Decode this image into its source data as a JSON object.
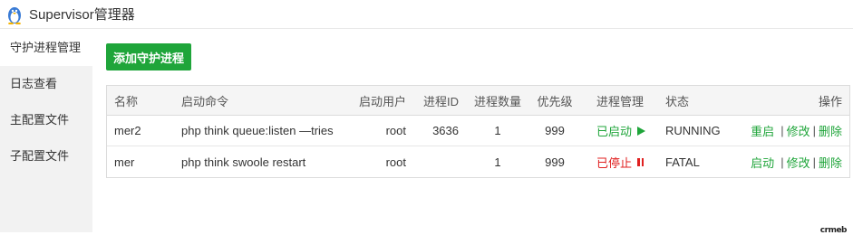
{
  "header": {
    "title": "Supervisor管理器",
    "logo_icon": "penguin-icon"
  },
  "sidebar": {
    "items": [
      {
        "label": "守护进程管理",
        "active": true
      },
      {
        "label": "日志查看",
        "active": false
      },
      {
        "label": "主配置文件",
        "active": false
      },
      {
        "label": "子配置文件",
        "active": false
      }
    ]
  },
  "main": {
    "add_button_label": "添加守护进程",
    "table": {
      "headers": {
        "name": "名称",
        "command": "启动命令",
        "user": "启动用户",
        "pid": "进程ID",
        "count": "进程数量",
        "priority": "优先级",
        "management": "进程管理",
        "state": "状态",
        "operations": "操作"
      },
      "rows": [
        {
          "name": "mer2",
          "command": "php think queue:listen —tries",
          "user": "root",
          "pid": "3636",
          "count": "1",
          "priority": "999",
          "management": "已启动",
          "management_icon": "play-icon",
          "state": "RUNNING",
          "op_primary": "重启",
          "op_edit": "修改",
          "op_delete": "删除"
        },
        {
          "name": "mer",
          "command": "php think swoole restart",
          "user": "root",
          "pid": "",
          "count": "1",
          "priority": "999",
          "management": "已停止",
          "management_icon": "pause-icon",
          "state": "FATAL",
          "op_primary": "启动",
          "op_edit": "修改",
          "op_delete": "删除"
        }
      ],
      "separator": "|"
    }
  },
  "brand": "crmeb",
  "colors": {
    "accent_green": "#1fa53a",
    "stopped_red": "#e02020",
    "sidebar_bg": "#f2f2f2"
  }
}
